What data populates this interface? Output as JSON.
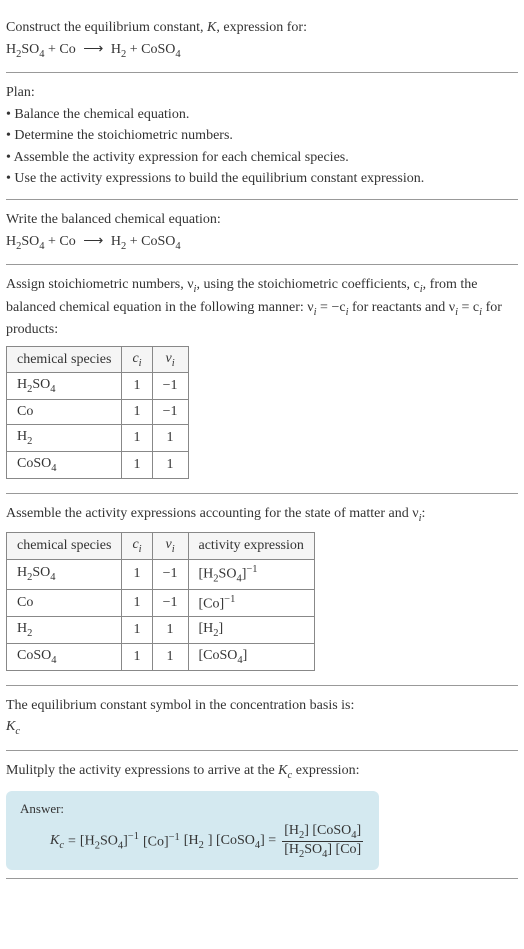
{
  "intro": {
    "prompt": "Construct the equilibrium constant, K, expression for:",
    "equation_lhs1": "H",
    "equation_lhs1_sub1": "2",
    "equation_lhs1_part2": "SO",
    "equation_lhs1_sub2": "4",
    "plus1": " + Co",
    "arrow": "⟶",
    "equation_rhs1": "H",
    "equation_rhs1_sub": "2",
    "plus2": " + CoSO",
    "equation_rhs2_sub": "4"
  },
  "plan": {
    "title": "Plan:",
    "b1": "• Balance the chemical equation.",
    "b2": "• Determine the stoichiometric numbers.",
    "b3": "• Assemble the activity expression for each chemical species.",
    "b4": "• Use the activity expressions to build the equilibrium constant expression."
  },
  "balanced": {
    "title": "Write the balanced chemical equation:"
  },
  "stoich": {
    "intro1": "Assign stoichiometric numbers, ν",
    "intro1_sub": "i",
    "intro2": ", using the stoichiometric coefficients, c",
    "intro2_sub": "i",
    "intro3": ", from the balanced chemical equation in the following manner: ν",
    "intro3_sub": "i",
    "intro4": " = −c",
    "intro4_sub": "i",
    "intro5": " for reactants and ν",
    "intro5_sub": "i",
    "intro6": " = c",
    "intro6_sub": "i",
    "intro7": " for products:",
    "headers": {
      "species": "chemical species",
      "ci": "c",
      "ci_sub": "i",
      "vi": "ν",
      "vi_sub": "i"
    },
    "rows": [
      {
        "species_p1": "H",
        "species_s1": "2",
        "species_p2": "SO",
        "species_s2": "4",
        "ci": "1",
        "vi": "−1"
      },
      {
        "species_p1": "Co",
        "species_s1": "",
        "species_p2": "",
        "species_s2": "",
        "ci": "1",
        "vi": "−1"
      },
      {
        "species_p1": "H",
        "species_s1": "2",
        "species_p2": "",
        "species_s2": "",
        "ci": "1",
        "vi": "1"
      },
      {
        "species_p1": "CoSO",
        "species_s1": "4",
        "species_p2": "",
        "species_s2": "",
        "ci": "1",
        "vi": "1"
      }
    ]
  },
  "activity": {
    "title1": "Assemble the activity expressions accounting for the state of matter and ν",
    "title1_sub": "i",
    "title2": ":",
    "headers": {
      "species": "chemical species",
      "ci": "c",
      "ci_sub": "i",
      "vi": "ν",
      "vi_sub": "i",
      "act": "activity expression"
    },
    "rows": [
      {
        "sp_p1": "H",
        "sp_s1": "2",
        "sp_p2": "SO",
        "sp_s2": "4",
        "ci": "1",
        "vi": "−1",
        "act_p1": "[H",
        "act_s1": "2",
        "act_p2": "SO",
        "act_s2": "4",
        "act_p3": "]",
        "act_sup": "−1"
      },
      {
        "sp_p1": "Co",
        "sp_s1": "",
        "sp_p2": "",
        "sp_s2": "",
        "ci": "1",
        "vi": "−1",
        "act_p1": "[Co]",
        "act_s1": "",
        "act_p2": "",
        "act_s2": "",
        "act_p3": "",
        "act_sup": "−1"
      },
      {
        "sp_p1": "H",
        "sp_s1": "2",
        "sp_p2": "",
        "sp_s2": "",
        "ci": "1",
        "vi": "1",
        "act_p1": "[H",
        "act_s1": "2",
        "act_p2": "]",
        "act_s2": "",
        "act_p3": "",
        "act_sup": ""
      },
      {
        "sp_p1": "CoSO",
        "sp_s1": "4",
        "sp_p2": "",
        "sp_s2": "",
        "ci": "1",
        "vi": "1",
        "act_p1": "[CoSO",
        "act_s1": "4",
        "act_p2": "]",
        "act_s2": "",
        "act_p3": "",
        "act_sup": ""
      }
    ]
  },
  "symbol": {
    "line1": "The equilibrium constant symbol in the concentration basis is:",
    "kc_k": "K",
    "kc_sub": "c"
  },
  "multiply": {
    "line1": "Mulitply the activity expressions to arrive at the ",
    "kc_k": "K",
    "kc_sub": "c",
    "line2": " expression:"
  },
  "answer": {
    "label": "Answer:",
    "kc_k": "K",
    "kc_sub": "c",
    "eq": " = ",
    "t1": "[H",
    "t1s": "2",
    "t2": "SO",
    "t2s": "4",
    "t3": "]",
    "t3sup": "−1",
    "t4": " [Co]",
    "t4sup": "−1",
    "t5": " [H",
    "t5s": "2",
    "t6": "] [CoSO",
    "t6s": "4",
    "t7": "] = ",
    "num1": "[H",
    "num1s": "2",
    "num2": "] [CoSO",
    "num2s": "4",
    "num3": "]",
    "den1": "[H",
    "den1s": "2",
    "den2": "SO",
    "den2s": "4",
    "den3": "] [Co]"
  }
}
